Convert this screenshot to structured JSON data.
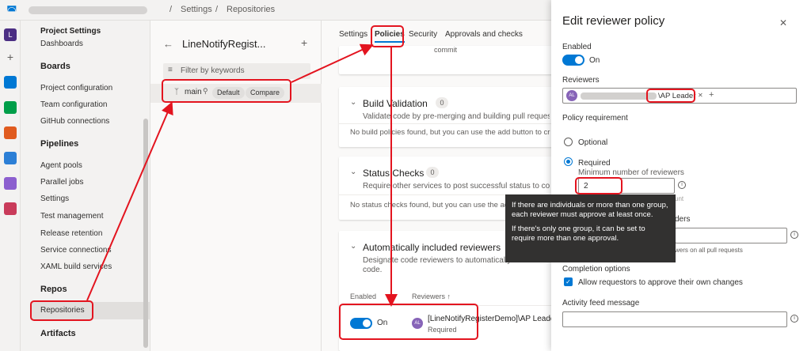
{
  "topbar": {
    "breadcrumb_sep1": "/",
    "settings": "Settings",
    "breadcrumb_sep2": "/",
    "repositories": "Repositories"
  },
  "nav": {
    "title": "Project Settings",
    "items_top": [
      "Dashboards"
    ],
    "boards_header": "Boards",
    "boards_items": [
      "Project configuration",
      "Team configuration",
      "GitHub connections"
    ],
    "pipelines_header": "Pipelines",
    "pipelines_items": [
      "Agent pools",
      "Parallel jobs",
      "Settings",
      "Test management",
      "Release retention",
      "Service connections",
      "XAML build services"
    ],
    "repos_header": "Repos",
    "repos_items": [
      "Repositories"
    ],
    "artifacts_header": "Artifacts"
  },
  "repo": {
    "back": "←",
    "name": "LineNotifyRegist...",
    "add": "+",
    "filter_placeholder": "Filter by keywords",
    "branch": "main",
    "badge_default": "Default",
    "badge_compare": "Compare"
  },
  "tabs": [
    "Settings",
    "Policies",
    "Security",
    "Approvals and checks"
  ],
  "cards": {
    "top_text": "commit",
    "build": {
      "title": "Build Validation",
      "count": "0",
      "desc": "Validate code by pre-merging and building pull request c",
      "none": "No build policies found, but you can use the add button to cr"
    },
    "status": {
      "title": "Status Checks",
      "count": "0",
      "desc": "Require other services to post successful status to comple",
      "none": "No status checks found, but you can use the add b"
    },
    "auto": {
      "title": "Automatically included reviewers",
      "desc1": "Designate code reviewers to automatically",
      "desc2": "code.",
      "col_enabled": "Enabled",
      "col_reviewers": "Reviewers ↑",
      "toggle_state": "On",
      "reviewer_name": "[LineNotifyRegisterDemo]\\AP Leade",
      "reviewer_req": "Required",
      "avatar": "AL"
    }
  },
  "panel": {
    "title": "Edit reviewer policy",
    "close": "✕",
    "enabled_label": "Enabled",
    "enabled_state": "On",
    "reviewers_label": "Reviewers",
    "reviewer_tag": "\\AP Leader",
    "reviewer_avatar": "AL",
    "tag_remove": "✕",
    "tag_add": "+",
    "policy_label": "Policy requirement",
    "optional": "Optional",
    "required": "Required",
    "min_label": "Minimum number of reviewers",
    "min_value": "2",
    "min_hint": "unt",
    "header_tail": "ders",
    "pr_hint": "wers on all pull requests",
    "completion_label": "Completion options",
    "allow_label": "Allow requestors to approve their own changes",
    "activity_label": "Activity feed message",
    "info": "i"
  },
  "tooltip": {
    "p1": "If there are individuals or more than one group, each reviewer must approve at least once.",
    "p2": "If there's only one group, it can be set to require more than one approval."
  },
  "colors": {
    "accent": "#0078d4",
    "annotation": "#e3141f"
  }
}
